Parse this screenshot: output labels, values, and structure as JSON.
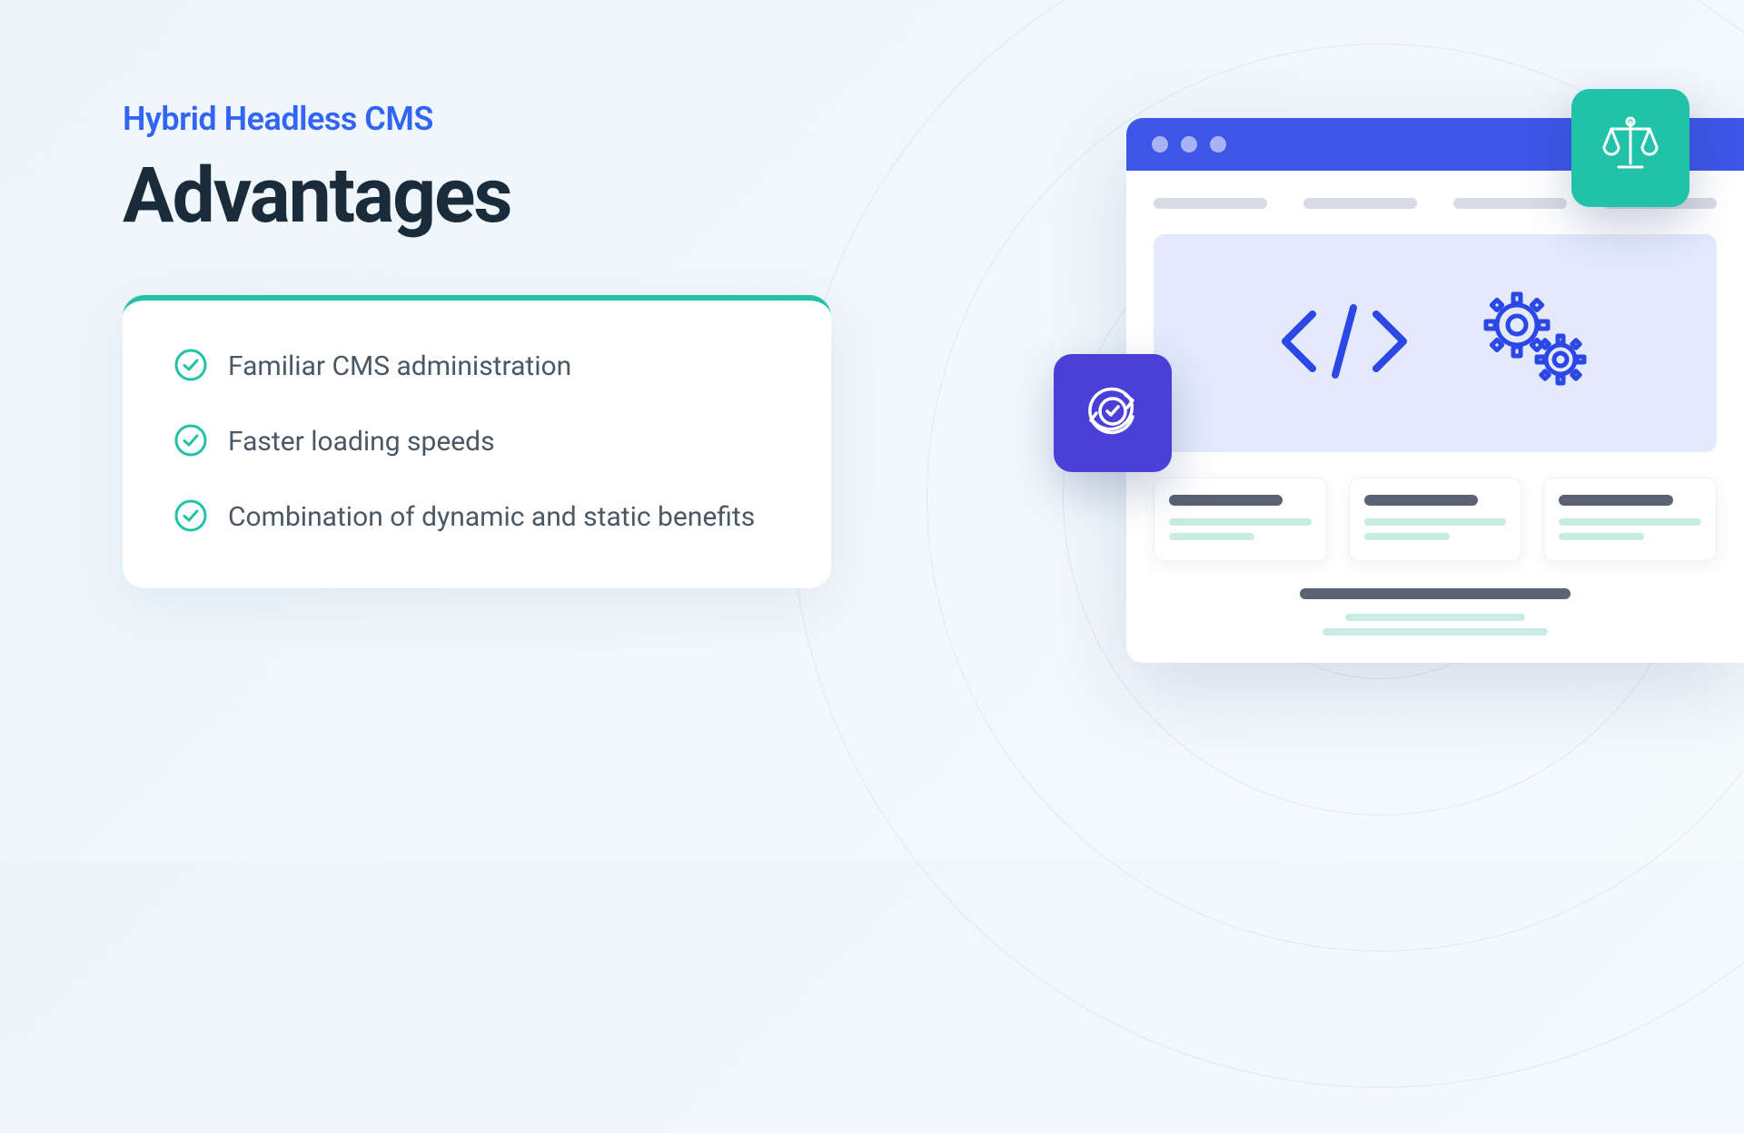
{
  "eyebrow": "Hybrid Headless CMS",
  "title": "Advantages",
  "features": [
    "Familiar CMS administration",
    "Faster loading speeds",
    "Combination of dynamic and static benefits"
  ],
  "colors": {
    "accent_blue": "#3264f5",
    "teal": "#21c2a7",
    "purple": "#4a3fd6",
    "browser_bar": "#3e56e8"
  },
  "icons": {
    "check": "check-circle",
    "scales": "scales-of-justice",
    "refresh": "refresh-check",
    "code": "code-brackets",
    "gears": "gears"
  }
}
